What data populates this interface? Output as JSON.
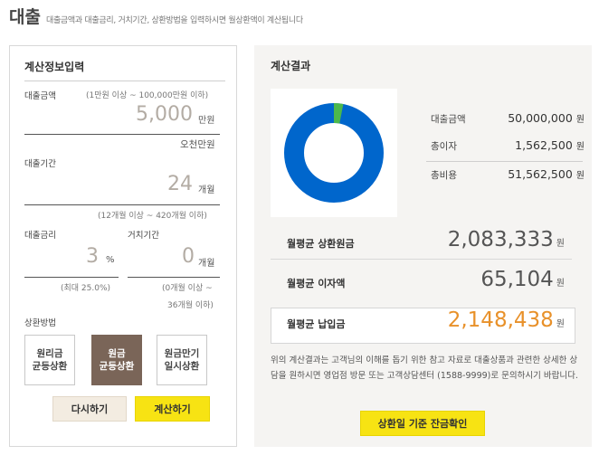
{
  "header": {
    "title": "대출",
    "description": "대출금액과 대출금리, 거치기간, 상환방법을 입력하시면 월상환액이 계산됩니다"
  },
  "input_panel": {
    "title": "계산정보입력",
    "amount": {
      "label": "대출금액",
      "range_hint": "(1만원 이상 ~ 100,000만원 이하)",
      "value": "5,000",
      "unit": "만원",
      "korean": "오천만원"
    },
    "period": {
      "label": "대출기간",
      "value": "24",
      "unit": "개월",
      "range_hint": "(12개월 이상 ~ 420개월 이하)"
    },
    "rate": {
      "label": "대출금리",
      "value": "3",
      "unit": "%",
      "hint": "(최대 25.0%)"
    },
    "grace": {
      "label": "거치기간",
      "value": "0",
      "unit": "개월",
      "hint_line1": "(0개월 이상 ~",
      "hint_line2": "36개월 이하)"
    },
    "method": {
      "label": "상환방법",
      "options": [
        "원리금\n균등상환",
        "원금\n균등상환",
        "원금만기\n일시상환"
      ],
      "selected": "원금\n균등상환"
    },
    "reset_label": "다시하기",
    "calc_label": "계산하기"
  },
  "result_panel": {
    "title": "계산결과",
    "stats": [
      {
        "label": "대출금액",
        "value": "50,000,000",
        "unit": "원"
      },
      {
        "label": "총이자",
        "value": "1,562,500",
        "unit": "원"
      },
      {
        "label": "총비용",
        "value": "51,562,500",
        "unit": "원"
      }
    ],
    "monthly_principal": {
      "label": "월평균 상환원금",
      "value": "2,083,333",
      "unit": "원"
    },
    "monthly_interest": {
      "label": "월평균 이자액",
      "value": "65,104",
      "unit": "원"
    },
    "monthly_payment": {
      "label": "월평균 납입금",
      "value": "2,148,438",
      "unit": "원"
    },
    "note": "위의 계산결과는 고객님의 이해를 돕기 위한 참고 자료로 대출상품과 관련한 상세한 상담을 원하시면 영업점 방문 또는 고객상담센터 (1588-9999)로 문의하시기 바랍니다.",
    "confirm_label": "상환일 기준 잔금확인"
  },
  "colors": {
    "principal": "#0066cc",
    "interest": "#4cb84c",
    "accent_yellow": "#f7e313",
    "selected_method": "#7a6558",
    "payment_orange": "#e8912a"
  },
  "donut": {
    "principal": 50000000,
    "interest": 1562500
  }
}
